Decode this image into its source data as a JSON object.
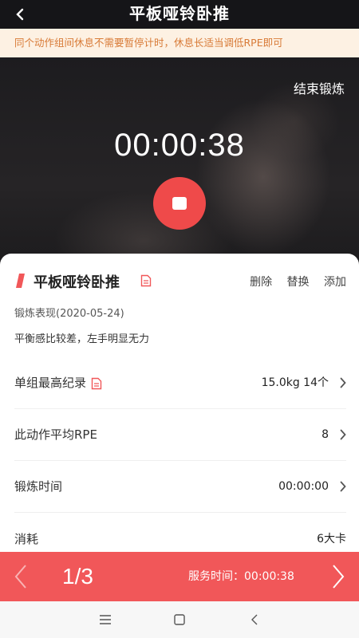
{
  "header": {
    "title": "平板哑铃卧推"
  },
  "notice": "同个动作组间休息不需要暂停计时，休息长适当调低RPE即可",
  "hero": {
    "end_label": "结束锻炼",
    "timer": "00:00:38"
  },
  "exercise": {
    "name": "平板哑铃卧推",
    "actions": {
      "delete": "删除",
      "replace": "替换",
      "add": "添加"
    },
    "performance_label": "锻炼表现(2020-05-24)",
    "performance_note": "平衡感比较差，左手明显无力"
  },
  "rows": [
    {
      "label": "单组最高纪录",
      "value": "15.0kg 14个"
    },
    {
      "label": "此动作平均RPE",
      "value": "8"
    },
    {
      "label": "锻炼时间",
      "value": "00:00:00"
    },
    {
      "label": "消耗",
      "value": "6大卡"
    }
  ],
  "footer": {
    "page": "1/3",
    "service_time": "服务时间：00:00:38"
  },
  "colors": {
    "accent": "#f15759",
    "stop_button": "#ef4a4a",
    "notice_text": "#d87a36",
    "notice_bg": "#fdf1e3"
  },
  "icons": [
    "back-arrow-icon",
    "stop-icon",
    "document-icon",
    "chevron-right-icon",
    "prev-arrow-icon",
    "next-arrow-icon",
    "menu-icon",
    "home-icon",
    "back-nav-icon"
  ]
}
